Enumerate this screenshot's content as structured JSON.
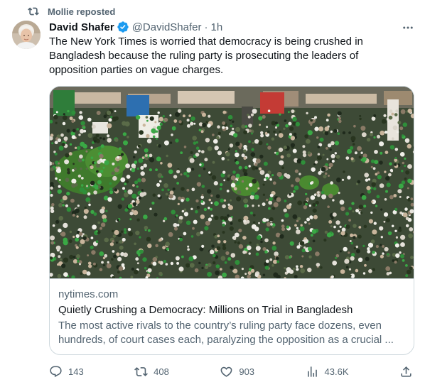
{
  "repost": {
    "label": "Mollie reposted",
    "icon": "repost-icon"
  },
  "tweet": {
    "author_name": "David Shafer",
    "handle": "@DavidShafer",
    "separator": "·",
    "time": "1h",
    "verified_icon": "verified-badge-icon",
    "text": "The New York Times is worried that democracy is being crushed in Bangladesh because the ruling party is prosecuting the leaders of opposition parties on vague charges."
  },
  "card": {
    "domain": "nytimes.com",
    "title": "Quietly Crushing a Democracy: Millions on Trial in Bangladesh",
    "description": "The most active rivals to the country’s ruling party face dozens, even hundreds, of court cases each, paralyzing the opposition as a crucial ..."
  },
  "actions": {
    "replies": {
      "count": "143",
      "icon": "reply-icon"
    },
    "reposts": {
      "count": "408",
      "icon": "repost-icon"
    },
    "likes": {
      "count": "903",
      "icon": "like-icon"
    },
    "views": {
      "count": "43.6K",
      "icon": "views-icon"
    },
    "share": {
      "icon": "share-icon"
    }
  },
  "colors": {
    "text_primary": "#0f1419",
    "text_secondary": "#536471",
    "verified": "#1d9bf0",
    "border": "#cfd9de"
  }
}
